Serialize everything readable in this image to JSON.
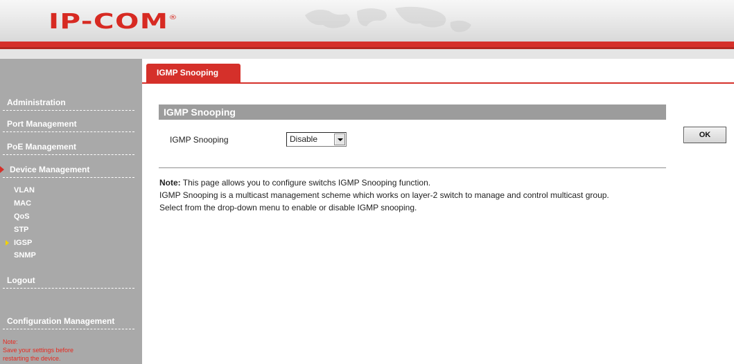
{
  "header": {
    "logo_text": "IP-COM",
    "logo_mark": "®",
    "brand_color": "#d72a22"
  },
  "sidebar": {
    "items": [
      {
        "label": "Administration"
      },
      {
        "label": "Port Management"
      },
      {
        "label": "PoE Management"
      },
      {
        "label": "Device Management",
        "active": true
      }
    ],
    "subitems": [
      {
        "label": "VLAN"
      },
      {
        "label": "MAC"
      },
      {
        "label": "QoS"
      },
      {
        "label": "STP"
      },
      {
        "label": "IGSP",
        "active": true
      },
      {
        "label": "SNMP"
      }
    ],
    "logout": "Logout",
    "config_mgmt": "Configuration Management",
    "note_title": "Note:",
    "note_line1": "Save your settings before",
    "note_line2": "restarting the device."
  },
  "tab": {
    "label": "IGMP Snooping"
  },
  "section": {
    "title": "IGMP Snooping",
    "field_label": "IGMP Snooping",
    "select_value": "Disable",
    "ok_label": "OK"
  },
  "note": {
    "prefix": "Note:",
    "line1": " This page allows you to configure switchs IGMP Snooping function.",
    "line2": "IGMP Snooping is a multicast management scheme which works on layer-2 switch to manage and control multicast group.",
    "line3": "Select from the drop-down menu to enable or disable IGMP snooping."
  },
  "colors": {
    "accent_red": "#d5302a",
    "sidebar_grey": "#a9a9a9",
    "section_grey": "#9c9c9c",
    "note_red": "#e62a20",
    "active_arrow_yellow": "#f2d200"
  }
}
